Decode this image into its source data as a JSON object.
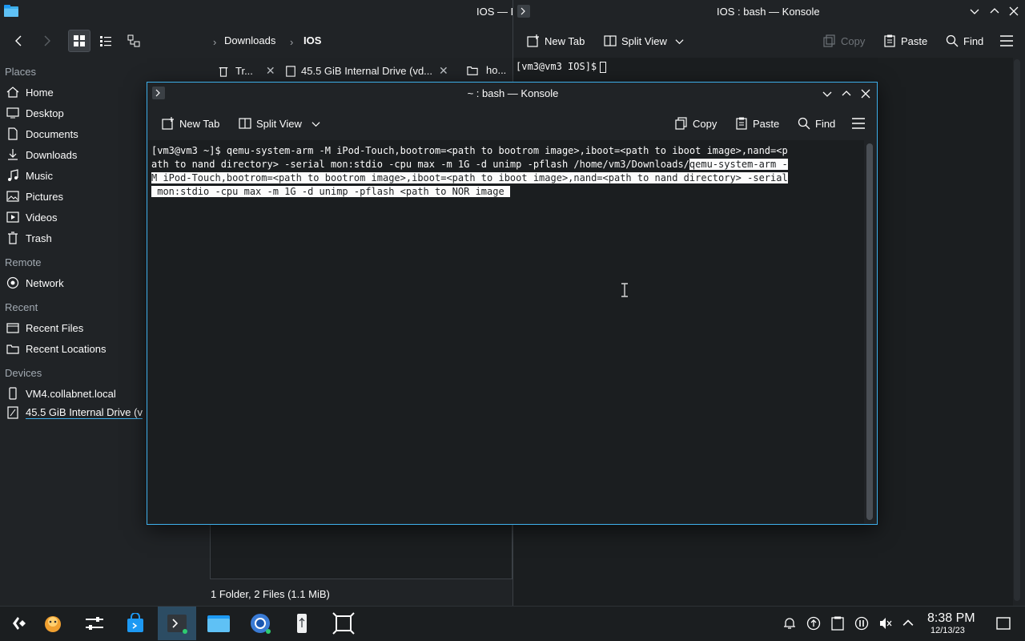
{
  "dolphin": {
    "title": "IOS — D",
    "breadcrumb": {
      "parent": "Downloads",
      "current": "IOS"
    },
    "places": {
      "section_places": "Places",
      "items": [
        "Home",
        "Desktop",
        "Documents",
        "Downloads",
        "Music",
        "Pictures",
        "Videos",
        "Trash"
      ],
      "section_remote": "Remote",
      "network": "Network",
      "section_recent": "Recent",
      "recent_files": "Recent Files",
      "recent_locations": "Recent Locations",
      "section_devices": "Devices",
      "device_1": "VM4.collabnet.local",
      "device_2": "45.5 GiB Internal Drive (v"
    },
    "tabs": [
      {
        "label": "Tr..."
      },
      {
        "label": "45.5 GiB Internal Drive (vd..."
      },
      {
        "label": "ho..."
      }
    ],
    "status": "1 Folder, 2 Files (1.1 MiB)"
  },
  "konsole_bg": {
    "title": "IOS : bash — Konsole",
    "new_tab": "New Tab",
    "split_view": "Split View",
    "copy": "Copy",
    "paste": "Paste",
    "find": "Find",
    "prompt": "[vm3@vm3 IOS]$"
  },
  "konsole_front": {
    "title": "~ : bash — Konsole",
    "new_tab": "New Tab",
    "split_view": "Split View",
    "copy": "Copy",
    "paste": "Paste",
    "find": "Find",
    "line1": "[vm3@vm3 ~]$ qemu-system-arm -M iPod-Touch,bootrom=<path to bootrom image>,iboot=<path to iboot image>,nand=<p",
    "line2_plain": "ath to nand directory> -serial mon:stdio -cpu max -m 1G -d unimp -pflash /home/vm3/Downloads/",
    "line2_sel": "qemu-system-arm -",
    "line3_sel": "M iPod-Touch,bootrom=<path to bootrom image>,iboot=<path to iboot image>,nand=<path to nand directory> -serial",
    "line4_sel": " mon:stdio -cpu max -m 1G -d unimp -pflash <path to NOR image "
  },
  "taskbar": {
    "time": "8:38 PM",
    "date": "12/13/23"
  }
}
